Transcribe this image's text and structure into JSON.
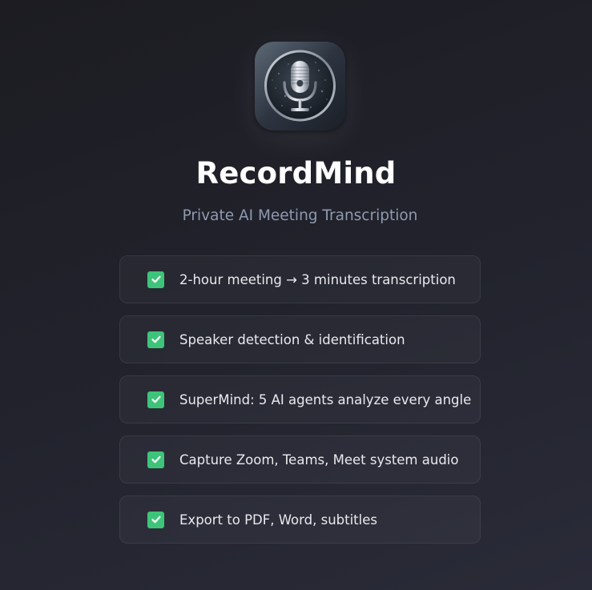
{
  "app": {
    "name": "RecordMind",
    "tagline": "Private AI Meeting Transcription",
    "icon": "microphone-icon"
  },
  "features": [
    {
      "text": "2-hour meeting → 3 minutes transcription",
      "icon": "check-icon",
      "color": "#3ec47a"
    },
    {
      "text": "Speaker detection & identification",
      "icon": "check-icon",
      "color": "#3ec47a"
    },
    {
      "text": "SuperMind: 5 AI agents analyze every angle",
      "icon": "check-icon",
      "color": "#3ec47a"
    },
    {
      "text": "Capture Zoom, Teams, Meet system audio",
      "icon": "check-icon",
      "color": "#3ec47a"
    },
    {
      "text": "Export to PDF, Word, subtitles",
      "icon": "check-icon",
      "color": "#3ec47a"
    }
  ],
  "colors": {
    "background": "#1f2028",
    "accent": "#3ec47a",
    "title": "#ffffff",
    "subtitle": "#8f9ab0"
  }
}
